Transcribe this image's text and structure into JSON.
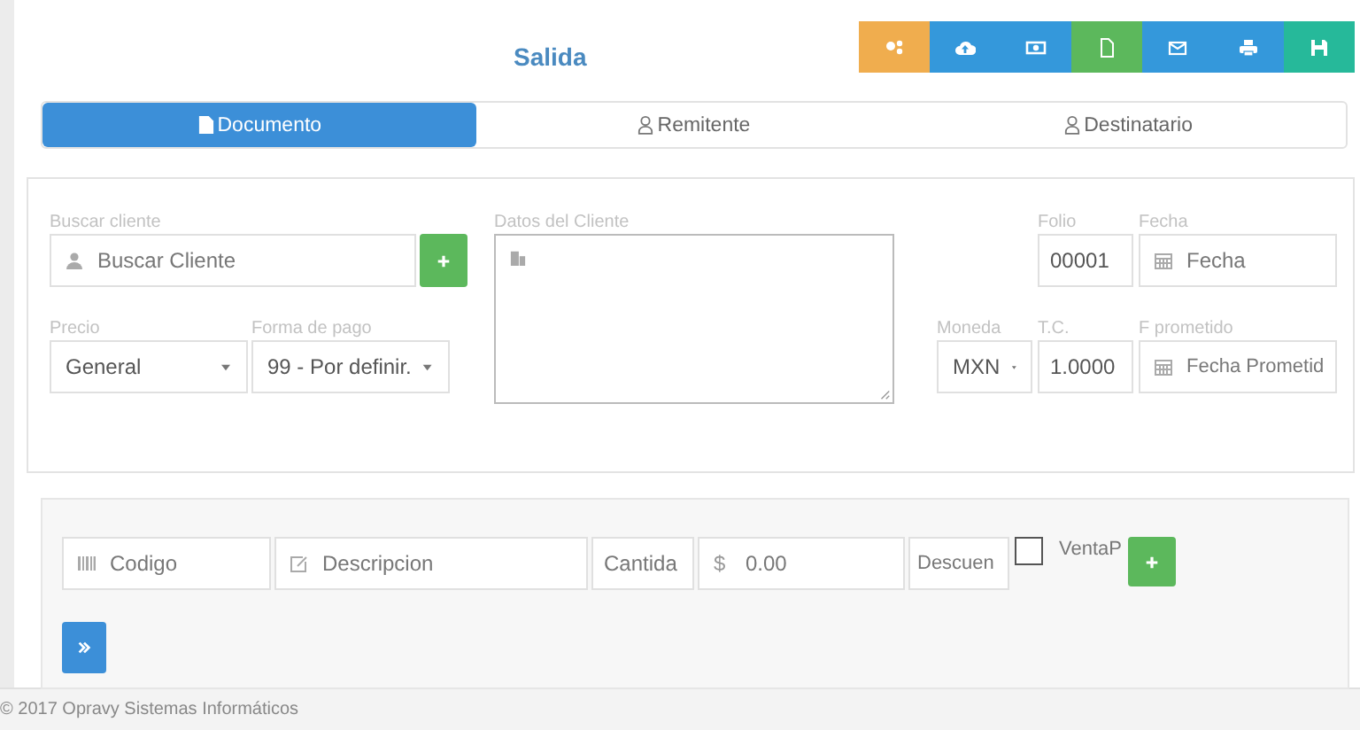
{
  "title": "Salida",
  "toolbar": [
    {
      "kind": "users",
      "color": "#f0ad4e"
    },
    {
      "kind": "cloud-upload",
      "color": "#3498db"
    },
    {
      "kind": "money",
      "color": "#3498db"
    },
    {
      "kind": "file",
      "color": "#5cb85c"
    },
    {
      "kind": "envelope",
      "color": "#3498db"
    },
    {
      "kind": "print",
      "color": "#3498db"
    },
    {
      "kind": "save",
      "color": "#26b99a"
    }
  ],
  "tabs": [
    {
      "label": "Documento",
      "kind": "document",
      "selected": true
    },
    {
      "label": "Remitente",
      "kind": "person",
      "selected": false
    },
    {
      "label": "Destinatario",
      "kind": "person",
      "selected": false
    }
  ],
  "cliente": {
    "label": "Buscar cliente",
    "placeholder": "Buscar Cliente"
  },
  "datos_cliente": {
    "label": "Datos del Cliente"
  },
  "folio": {
    "label": "Folio",
    "value": "00001"
  },
  "fecha": {
    "label": "Fecha",
    "placeholder": "Fecha"
  },
  "precio": {
    "label": "Precio",
    "value": "General"
  },
  "forma_pago": {
    "label": "Forma de pago",
    "value": "99 - Por definir."
  },
  "moneda": {
    "label": "Moneda",
    "value": "MXN"
  },
  "tc": {
    "label": "T.C.",
    "value": "1.0000"
  },
  "f_prometido": {
    "label": "F prometido",
    "placeholder": "Fecha Prometid"
  },
  "item": {
    "codigo": {
      "placeholder": "Codigo"
    },
    "descripcion": {
      "placeholder": "Descripcion"
    },
    "cantidad": {
      "placeholder": "Cantida"
    },
    "precio": {
      "prefix": "$",
      "placeholder": "0.00"
    },
    "descuento": {
      "placeholder": "Descuen"
    }
  },
  "venta": {
    "label": "VentaP",
    "checked": false
  },
  "footer": "© 2017 Opravy Sistemas Informáticos"
}
